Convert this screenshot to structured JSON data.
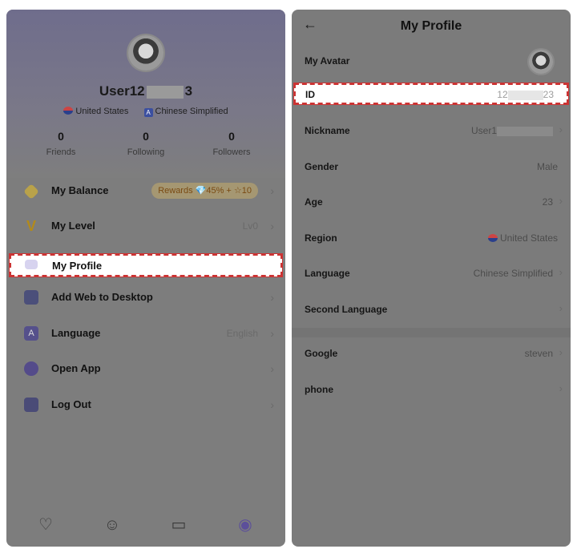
{
  "left": {
    "user_name_prefix": "User12",
    "user_name_suffix": "3",
    "country": "United States",
    "language": "Chinese Simplified",
    "stats": [
      {
        "value": "0",
        "label": "Friends"
      },
      {
        "value": "0",
        "label": "Following"
      },
      {
        "value": "0",
        "label": "Followers"
      }
    ],
    "menu": [
      {
        "label": "My Balance",
        "value": "Rewards 💎45% + ☆10",
        "icon": "diamond-icon"
      },
      {
        "label": "My Level",
        "value": "Lv0",
        "icon": "level-v-icon"
      },
      {
        "label": "My Profile",
        "value": "",
        "icon": "profile-card-icon"
      },
      {
        "label": "Add Web to Desktop",
        "value": "",
        "icon": "desktop-add-icon"
      },
      {
        "label": "Language",
        "value": "English",
        "icon": "language-icon"
      },
      {
        "label": "Open App",
        "value": "",
        "icon": "open-app-icon"
      },
      {
        "label": "Log Out",
        "value": "",
        "icon": "logout-icon"
      }
    ],
    "nav": [
      "heart-chat-icon",
      "friends-icon",
      "messages-icon",
      "profile-icon"
    ]
  },
  "right": {
    "title": "My Profile",
    "rows": [
      {
        "label": "My Avatar",
        "value": ""
      },
      {
        "label": "ID",
        "value_prefix": "12",
        "value_suffix": "23"
      },
      {
        "label": "Nickname",
        "value_prefix": "User1"
      },
      {
        "label": "Gender",
        "value": "Male"
      },
      {
        "label": "Age",
        "value": "23"
      },
      {
        "label": "Region",
        "value": "United States"
      },
      {
        "label": "Language",
        "value": "Chinese Simplified"
      },
      {
        "label": "Second Language",
        "value": ""
      },
      {
        "label": "Google",
        "value": "steven"
      },
      {
        "label": "phone",
        "value": ""
      }
    ]
  },
  "colors": {
    "highlight_border": "#cc3333",
    "accent_purple": "#6d6a96"
  }
}
